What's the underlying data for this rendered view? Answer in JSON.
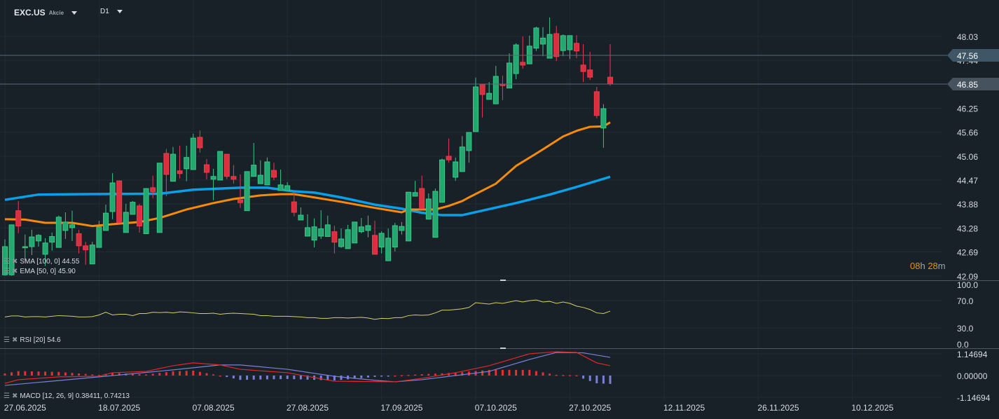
{
  "header": {
    "symbol": "EXC.US",
    "asset_type": "Akcie",
    "timeframe": "D1"
  },
  "legends": {
    "sma": "SMA [100,  0] 44.55",
    "ema": "EMA [50,  0] 45.90",
    "rsi": "RSI [20]  54.6",
    "macd": "MACD [12,  26,  9] 0.38411,  0.74213"
  },
  "countdown": {
    "hours": "08",
    "h": "h",
    "minutes": "28",
    "m": "m"
  },
  "colors": {
    "background": "#182028",
    "up": "#26a670",
    "down": "#d9303f",
    "sma": "#0aa0e8",
    "ema": "#f68a0a",
    "rsi": "#d8d060",
    "macd": "#e02828",
    "signal": "#7a80d8",
    "countdown": "#f0900a"
  },
  "chart_data": [
    {
      "type": "candlestick",
      "title": "",
      "price_ticks": [
        "48.03",
        "47.44",
        "46.25",
        "45.66",
        "45.06",
        "44.47",
        "43.88",
        "43.28",
        "42.69",
        "42.09"
      ],
      "price_range": [
        42.09,
        48.03
      ],
      "price_markers": [
        {
          "value": "47.56"
        },
        {
          "value": "46.85"
        }
      ],
      "x_ticks": [
        "27.06.2025",
        "18.07.2025",
        "07.08.2025",
        "27.08.2025",
        "17.09.2025",
        "07.10.2025",
        "27.10.2025",
        "12.11.2025",
        "26.11.2025",
        "10.12.2025"
      ],
      "grid": true,
      "candles_fields": [
        "date",
        "open",
        "high",
        "low",
        "close"
      ],
      "candles": [
        [
          "24.06",
          42.12,
          43.0,
          42.1,
          42.82
        ],
        [
          "25.06",
          42.12,
          43.36,
          42.1,
          43.36
        ],
        [
          "26.06",
          43.71,
          43.95,
          43.15,
          43.33
        ],
        [
          "27.06",
          42.79,
          43.12,
          42.46,
          42.82
        ],
        [
          "30.06",
          42.82,
          43.24,
          42.61,
          43.06
        ],
        [
          "01.07",
          42.96,
          43.13,
          42.82,
          43.1
        ],
        [
          "02.07",
          42.63,
          43.03,
          42.34,
          42.91
        ],
        [
          "03.07",
          42.93,
          43.17,
          42.72,
          43.07
        ],
        [
          "07.07",
          42.8,
          43.59,
          42.8,
          43.55
        ],
        [
          "08.07",
          43.22,
          43.67,
          43.01,
          43.43
        ],
        [
          "09.07",
          43.29,
          43.71,
          42.96,
          43.36
        ],
        [
          "10.07",
          43.14,
          43.24,
          42.65,
          42.84
        ],
        [
          "11.07",
          42.84,
          42.94,
          42.37,
          42.74
        ],
        [
          "14.07",
          42.39,
          42.94,
          42.39,
          42.86
        ],
        [
          "15.07",
          42.8,
          43.46,
          42.8,
          43.31
        ],
        [
          "16.07",
          43.22,
          43.86,
          43.22,
          43.65
        ],
        [
          "17.07",
          43.69,
          44.64,
          43.5,
          44.4
        ],
        [
          "18.07",
          44.45,
          44.45,
          43.41,
          43.41
        ],
        [
          "21.07",
          43.17,
          43.88,
          43.17,
          43.67
        ],
        [
          "22.07",
          43.62,
          43.95,
          43.62,
          43.92
        ],
        [
          "23.07",
          43.83,
          43.88,
          43.17,
          43.33
        ],
        [
          "24.07",
          43.14,
          44.26,
          43.13,
          44.26
        ],
        [
          "25.07",
          44.28,
          44.58,
          44.02,
          44.18
        ],
        [
          "28.07",
          43.17,
          44.89,
          43.17,
          44.89
        ],
        [
          "29.07",
          45.13,
          45.24,
          44.07,
          44.61
        ],
        [
          "30.07",
          44.44,
          45.29,
          44.44,
          45.11
        ],
        [
          "31.07",
          44.7,
          45.32,
          44.51,
          44.63
        ],
        [
          "01.08",
          44.75,
          45.32,
          44.44,
          45.03
        ],
        [
          "04.08",
          44.73,
          45.62,
          44.73,
          45.51
        ],
        [
          "05.08",
          45.53,
          45.7,
          45.15,
          45.27
        ],
        [
          "06.08",
          44.85,
          44.99,
          44.49,
          44.66
        ],
        [
          "07.08",
          44.49,
          44.75,
          43.97,
          44.56
        ],
        [
          "08.08",
          44.47,
          45.18,
          44.47,
          45.18
        ],
        [
          "11.08",
          45.11,
          45.11,
          44.49,
          44.56
        ],
        [
          "12.08",
          44.56,
          44.84,
          44.38,
          44.49
        ],
        [
          "13.08",
          43.98,
          44.61,
          43.78,
          43.91
        ],
        [
          "14.08",
          43.71,
          44.68,
          43.71,
          44.68
        ],
        [
          "15.08",
          44.56,
          45.39,
          44.56,
          44.84
        ],
        [
          "18.08",
          44.38,
          44.96,
          44.38,
          44.59
        ],
        [
          "19.08",
          44.35,
          45.03,
          44.35,
          44.92
        ],
        [
          "20.08",
          44.71,
          44.9,
          44.47,
          44.54
        ],
        [
          "21.08",
          44.21,
          44.73,
          44.21,
          44.35
        ],
        [
          "22.08",
          44.21,
          44.42,
          44.21,
          44.33
        ],
        [
          "25.08",
          43.93,
          44.18,
          43.57,
          43.67
        ],
        [
          "26.08",
          43.48,
          43.79,
          43.48,
          43.6
        ],
        [
          "27.08",
          43.08,
          43.62,
          43.08,
          43.29
        ],
        [
          "28.08",
          42.98,
          43.52,
          42.8,
          43.31
        ],
        [
          "29.08",
          43.08,
          43.72,
          43.01,
          43.26
        ],
        [
          "02.09",
          43.07,
          43.59,
          43.07,
          43.36
        ],
        [
          "03.09",
          43.19,
          43.34,
          42.65,
          42.93
        ],
        [
          "04.09",
          42.82,
          43.27,
          42.79,
          43.01
        ],
        [
          "05.09",
          42.77,
          43.36,
          42.77,
          43.24
        ],
        [
          "08.09",
          42.91,
          43.43,
          42.91,
          43.43
        ],
        [
          "09.09",
          43.19,
          43.53,
          43.15,
          43.31
        ],
        [
          "10.09",
          43.22,
          43.59,
          43.05,
          43.34
        ],
        [
          "11.09",
          43.1,
          43.46,
          42.63,
          42.63
        ],
        [
          "12.09",
          42.81,
          43.2,
          42.65,
          43.15
        ],
        [
          "15.09",
          42.47,
          43.27,
          42.47,
          43.03
        ],
        [
          "16.09",
          42.81,
          43.41,
          42.7,
          43.34
        ],
        [
          "17.09",
          43.22,
          43.43,
          43.12,
          43.32
        ],
        [
          "18.09",
          42.96,
          44.17,
          42.96,
          44.17
        ],
        [
          "19.09",
          44.07,
          44.45,
          44.07,
          44.16
        ],
        [
          "22.09",
          44.26,
          44.58,
          43.76,
          43.76
        ],
        [
          "23.09",
          43.5,
          44.14,
          43.5,
          44.0
        ],
        [
          "24.09",
          43.05,
          44.26,
          43.05,
          44.19
        ],
        [
          "25.09",
          43.92,
          45.0,
          43.92,
          44.97
        ],
        [
          "26.09",
          45.06,
          45.5,
          44.9,
          44.97
        ],
        [
          "29.09",
          44.54,
          45.03,
          44.45,
          44.92
        ],
        [
          "30.09",
          44.68,
          45.56,
          44.68,
          45.29
        ],
        [
          "01.10",
          45.2,
          45.65,
          44.9,
          45.65
        ],
        [
          "02.10",
          45.67,
          47.01,
          45.67,
          46.78
        ],
        [
          "03.10",
          46.85,
          46.85,
          46.02,
          46.59
        ],
        [
          "06.10",
          46.47,
          46.9,
          46.47,
          46.62
        ],
        [
          "07.10",
          46.36,
          47.3,
          46.36,
          47.04
        ],
        [
          "08.10",
          46.85,
          47.06,
          46.45,
          46.81
        ],
        [
          "09.10",
          46.75,
          47.61,
          46.75,
          47.37
        ],
        [
          "10.10",
          47.11,
          47.86,
          46.97,
          47.82
        ],
        [
          "13.10",
          47.39,
          48.03,
          47.23,
          47.32
        ],
        [
          "14.10",
          47.35,
          48.05,
          47.35,
          47.79
        ],
        [
          "15.10",
          47.74,
          48.27,
          47.67,
          48.24
        ],
        [
          "16.10",
          47.84,
          48.26,
          47.54,
          47.99
        ],
        [
          "17.10",
          47.49,
          48.5,
          47.49,
          48.08
        ],
        [
          "20.10",
          48.1,
          48.29,
          47.42,
          47.53
        ],
        [
          "21.10",
          47.68,
          48.08,
          47.54,
          48.05
        ],
        [
          "22.10",
          47.7,
          48.05,
          47.47,
          48.05
        ],
        [
          "23.10",
          47.86,
          48.06,
          47.49,
          47.67
        ],
        [
          "24.10",
          47.32,
          47.84,
          46.9,
          47.16
        ],
        [
          "27.10",
          47.2,
          47.65,
          46.95,
          47.02
        ],
        [
          "28.10",
          46.66,
          46.78,
          46.0,
          46.07
        ],
        [
          "29.10",
          45.76,
          46.35,
          45.27,
          46.24
        ],
        [
          "30.10",
          47.02,
          47.84,
          46.81,
          46.85
        ]
      ],
      "sma_100": [
        [
          "24.06",
          43.98
        ],
        [
          "01.07",
          44.11
        ],
        [
          "10.07",
          44.12
        ],
        [
          "28.07",
          44.13
        ],
        [
          "04.08",
          44.23
        ],
        [
          "13.08",
          44.28
        ],
        [
          "19.08",
          44.28
        ],
        [
          "25.08",
          44.19
        ],
        [
          "28.08",
          44.16
        ],
        [
          "04.09",
          44.04
        ],
        [
          "11.09",
          43.86
        ],
        [
          "17.09",
          43.76
        ],
        [
          "22.09",
          43.66
        ],
        [
          "25.09",
          43.6
        ],
        [
          "30.09",
          43.6
        ],
        [
          "10.10",
          43.9
        ],
        [
          "17.10",
          44.11
        ],
        [
          "23.10",
          44.3
        ],
        [
          "30.10",
          44.55
        ]
      ],
      "ema_50": [
        [
          "24.06",
          43.5
        ],
        [
          "27.06",
          43.49
        ],
        [
          "02.07",
          43.41
        ],
        [
          "09.07",
          43.41
        ],
        [
          "14.07",
          43.33
        ],
        [
          "18.07",
          43.39
        ],
        [
          "23.07",
          43.43
        ],
        [
          "28.07",
          43.53
        ],
        [
          "01.08",
          43.74
        ],
        [
          "07.08",
          43.9
        ],
        [
          "12.08",
          44.0
        ],
        [
          "18.08",
          44.09
        ],
        [
          "21.08",
          44.12
        ],
        [
          "25.08",
          44.12
        ],
        [
          "28.08",
          44.04
        ],
        [
          "04.09",
          43.93
        ],
        [
          "11.09",
          43.78
        ],
        [
          "17.09",
          43.67
        ],
        [
          "18.09",
          43.74
        ],
        [
          "24.09",
          43.74
        ],
        [
          "26.09",
          43.83
        ],
        [
          "30.09",
          43.95
        ],
        [
          "01.10",
          44.04
        ],
        [
          "07.10",
          44.38
        ],
        [
          "10.10",
          44.82
        ],
        [
          "16.10",
          45.23
        ],
        [
          "21.10",
          45.55
        ],
        [
          "23.10",
          45.69
        ],
        [
          "27.10",
          45.79
        ],
        [
          "29.10",
          45.8
        ],
        [
          "30.10",
          45.9
        ]
      ]
    },
    {
      "type": "line",
      "title": "RSI [20]",
      "y_ticks": [
        "100.0",
        "70.0",
        "30.0",
        "0.0"
      ],
      "ylim": [
        0,
        100
      ],
      "values": [
        46,
        47.5,
        47.5,
        46,
        46.5,
        46.5,
        46,
        47,
        48,
        47.5,
        47,
        46,
        46,
        46.5,
        49,
        53,
        49,
        50,
        50,
        48,
        51,
        51,
        53,
        52.5,
        53,
        52,
        53.5,
        53,
        52,
        51,
        51,
        51.5,
        50,
        51,
        51.5,
        51,
        50.5,
        50,
        48,
        48,
        47,
        47,
        47,
        46.5,
        46,
        45,
        45,
        44,
        44,
        45,
        45,
        44.5,
        45,
        45.5,
        44.5,
        42.5,
        44,
        43.5,
        45,
        45,
        48,
        49,
        48.5,
        49,
        52,
        56,
        56,
        57,
        58,
        60,
        67,
        66,
        65,
        67,
        66,
        68,
        70,
        68,
        70,
        71,
        68,
        69,
        66,
        68,
        66,
        62,
        60,
        57,
        52,
        51,
        54.6
      ]
    },
    {
      "type": "line",
      "title": "MACD [12, 26, 9]",
      "y_ticks": [
        "1.14694",
        "0.00000",
        "-1.14694"
      ],
      "ylim": [
        -1.14694,
        1.14694
      ],
      "macd": [
        [
          "24.06",
          -0.41
        ],
        [
          "26.06",
          -0.22
        ],
        [
          "07.07",
          -0.07
        ],
        [
          "15.07",
          -0.04
        ],
        [
          "17.07",
          0.15
        ],
        [
          "24.07",
          0.22
        ],
        [
          "30.07",
          0.52
        ],
        [
          "04.08",
          0.67
        ],
        [
          "08.08",
          0.56
        ],
        [
          "13.08",
          0.33
        ],
        [
          "22.08",
          0.15
        ],
        [
          "03.09",
          -0.3
        ],
        [
          "16.09",
          -0.33
        ],
        [
          "22.09",
          -0.15
        ],
        [
          "29.09",
          0.15
        ],
        [
          "06.10",
          0.52
        ],
        [
          "14.10",
          1.15
        ],
        [
          "20.10",
          1.26
        ],
        [
          "23.10",
          1.22
        ],
        [
          "28.10",
          0.67
        ],
        [
          "30.10",
          0.52
        ]
      ],
      "signal": [
        [
          "24.06",
          -0.52
        ],
        [
          "15.07",
          -0.07
        ],
        [
          "30.07",
          0.3
        ],
        [
          "08.08",
          0.56
        ],
        [
          "13.08",
          0.56
        ],
        [
          "22.08",
          0.33
        ],
        [
          "03.09",
          -0.04
        ],
        [
          "11.09",
          -0.25
        ],
        [
          "16.09",
          -0.33
        ],
        [
          "22.09",
          -0.22
        ],
        [
          "29.09",
          0.0
        ],
        [
          "06.10",
          0.22
        ],
        [
          "14.10",
          0.85
        ],
        [
          "20.10",
          1.22
        ],
        [
          "24.10",
          1.2
        ],
        [
          "30.10",
          0.96
        ]
      ]
    }
  ]
}
